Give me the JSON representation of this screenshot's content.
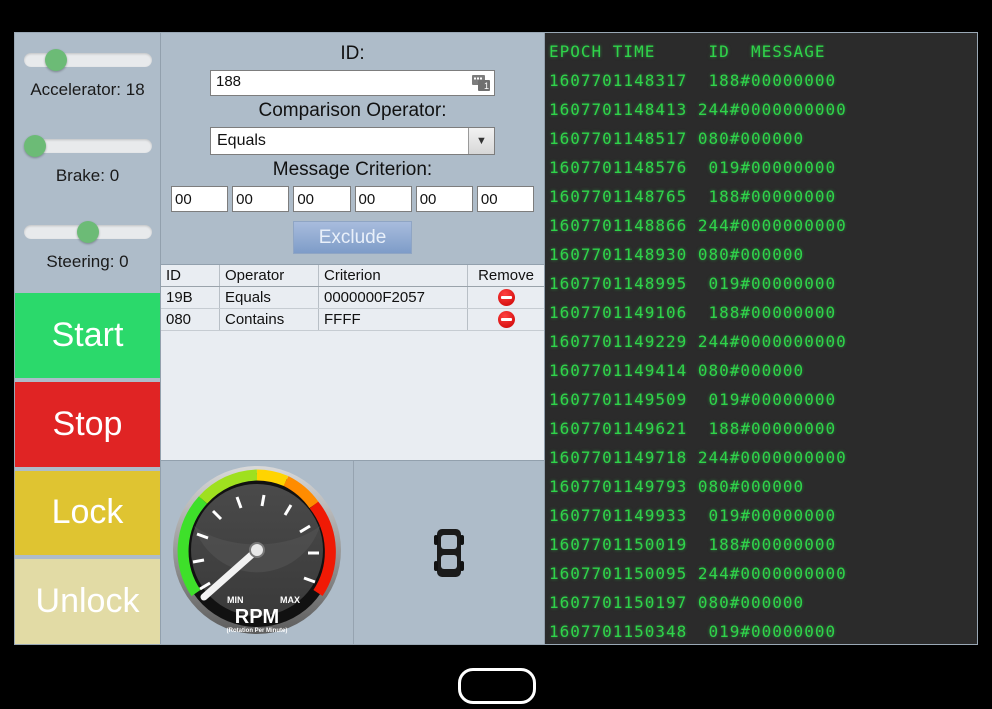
{
  "controls": {
    "sliders": [
      {
        "name": "accelerator",
        "label": "Accelerator: 18",
        "value": 18,
        "percent": 18
      },
      {
        "name": "brake",
        "label": "Brake: 0",
        "value": 0,
        "percent": 0
      },
      {
        "name": "steering",
        "label": "Steering: 0",
        "value": 0,
        "percent": 50
      }
    ],
    "buttons": [
      {
        "label": "Start",
        "color": "#2bd96b"
      },
      {
        "label": "Stop",
        "color": "#e02424"
      },
      {
        "label": "Lock",
        "color": "#dfc431"
      },
      {
        "label": "Unlock",
        "color": "#e2dba5"
      }
    ]
  },
  "filter_form": {
    "id_label": "ID:",
    "id_value": "188",
    "operator_label": "Comparison Operator:",
    "operator_value": "Equals",
    "operator_options": [
      "Equals",
      "Contains"
    ],
    "criterion_label": "Message Criterion:",
    "criterion_bytes": [
      "00",
      "00",
      "00",
      "00",
      "00",
      "00"
    ],
    "exclude_label": "Exclude"
  },
  "criteria_table": {
    "headers": [
      "ID",
      "Operator",
      "Criterion",
      "Remove"
    ],
    "rows": [
      {
        "id": "19B",
        "operator": "Equals",
        "criterion": "0000000F2057"
      },
      {
        "id": "080",
        "operator": "Contains",
        "criterion": "FFFF"
      }
    ]
  },
  "gauge": {
    "title": "RPM",
    "subtitle": "(Rotation Per Minute)",
    "min_label": "MIN",
    "max_label": "MAX",
    "value_percent": 4
  },
  "log": {
    "header": "EPOCH TIME     ID  MESSAGE",
    "lines": [
      "1607701148317  188#00000000",
      "1607701148413 244#0000000000",
      "1607701148517 080#000000",
      "1607701148576  019#00000000",
      "1607701148765  188#00000000",
      "1607701148866 244#0000000000",
      "1607701148930 080#000000",
      "1607701148995  019#00000000",
      "1607701149106  188#00000000",
      "1607701149229 244#0000000000",
      "1607701149414 080#000000",
      "1607701149509  019#00000000",
      "1607701149621  188#00000000",
      "1607701149718 244#0000000000",
      "1607701149793 080#000000",
      "1607701149933  019#00000000",
      "1607701150019  188#00000000",
      "1607701150095 244#0000000000",
      "1607701150197 080#000000",
      "1607701150348  019#00000000"
    ]
  },
  "device": {
    "home_button_label": ""
  }
}
